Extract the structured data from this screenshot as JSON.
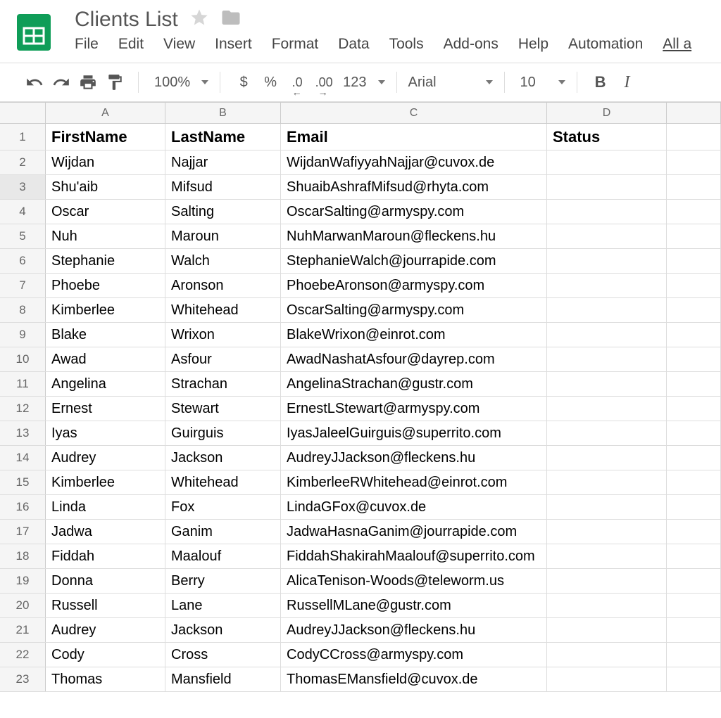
{
  "doc": {
    "title": "Clients List"
  },
  "menus": [
    "File",
    "Edit",
    "View",
    "Insert",
    "Format",
    "Data",
    "Tools",
    "Add-ons",
    "Help",
    "Automation",
    "All a"
  ],
  "toolbar": {
    "zoom": "100%",
    "currency": "$",
    "percent": "%",
    "dec_dec": ".0",
    "inc_dec": ".00",
    "more_fmt": "123",
    "font": "Arial",
    "font_size": "10",
    "bold": "B",
    "italic": "I"
  },
  "columns": [
    "A",
    "B",
    "C",
    "D",
    ""
  ],
  "headers": {
    "A": "FirstName",
    "B": "LastName",
    "C": "Email",
    "D": "Status"
  },
  "selected_row": 3,
  "rows": [
    {
      "n": 1,
      "first": "FirstName",
      "last": "LastName",
      "email": "Email",
      "status": "Status",
      "is_header": true
    },
    {
      "n": 2,
      "first": "Wijdan",
      "last": "Najjar",
      "email": "WijdanWafiyyahNajjar@cuvox.de",
      "status": ""
    },
    {
      "n": 3,
      "first": "Shu'aib",
      "last": "Mifsud",
      "email": "ShuaibAshrafMifsud@rhyta.com",
      "status": ""
    },
    {
      "n": 4,
      "first": "Oscar",
      "last": "Salting",
      "email": "OscarSalting@armyspy.com",
      "status": ""
    },
    {
      "n": 5,
      "first": "Nuh",
      "last": "Maroun",
      "email": "NuhMarwanMaroun@fleckens.hu",
      "status": ""
    },
    {
      "n": 6,
      "first": "Stephanie",
      "last": "Walch",
      "email": "StephanieWalch@jourrapide.com",
      "status": ""
    },
    {
      "n": 7,
      "first": "Phoebe",
      "last": "Aronson",
      "email": "PhoebeAronson@armyspy.com",
      "status": ""
    },
    {
      "n": 8,
      "first": "Kimberlee",
      "last": "Whitehead",
      "email": "OscarSalting@armyspy.com",
      "status": ""
    },
    {
      "n": 9,
      "first": "Blake",
      "last": "Wrixon",
      "email": "BlakeWrixon@einrot.com",
      "status": ""
    },
    {
      "n": 10,
      "first": "Awad",
      "last": "Asfour",
      "email": "AwadNashatAsfour@dayrep.com",
      "status": ""
    },
    {
      "n": 11,
      "first": "Angelina",
      "last": "Strachan",
      "email": "AngelinaStrachan@gustr.com",
      "status": ""
    },
    {
      "n": 12,
      "first": "Ernest",
      "last": "Stewart",
      "email": "ErnestLStewart@armyspy.com",
      "status": ""
    },
    {
      "n": 13,
      "first": "Iyas",
      "last": "Guirguis",
      "email": "IyasJaleelGuirguis@superrito.com",
      "status": ""
    },
    {
      "n": 14,
      "first": "Audrey",
      "last": "Jackson",
      "email": "AudreyJJackson@fleckens.hu",
      "status": ""
    },
    {
      "n": 15,
      "first": "Kimberlee",
      "last": "Whitehead",
      "email": "KimberleeRWhitehead@einrot.com",
      "status": ""
    },
    {
      "n": 16,
      "first": "Linda",
      "last": "Fox",
      "email": "LindaGFox@cuvox.de",
      "status": ""
    },
    {
      "n": 17,
      "first": "Jadwa",
      "last": "Ganim",
      "email": "JadwaHasnaGanim@jourrapide.com",
      "status": ""
    },
    {
      "n": 18,
      "first": "Fiddah",
      "last": "Maalouf",
      "email": "FiddahShakirahMaalouf@superrito.com",
      "status": ""
    },
    {
      "n": 19,
      "first": "Donna",
      "last": "Berry",
      "email": "AlicaTenison-Woods@teleworm.us",
      "status": ""
    },
    {
      "n": 20,
      "first": "Russell",
      "last": "Lane",
      "email": "RussellMLane@gustr.com",
      "status": ""
    },
    {
      "n": 21,
      "first": "Audrey",
      "last": "Jackson",
      "email": "AudreyJJackson@fleckens.hu",
      "status": ""
    },
    {
      "n": 22,
      "first": "Cody",
      "last": "Cross",
      "email": "CodyCCross@armyspy.com",
      "status": ""
    },
    {
      "n": 23,
      "first": "Thomas",
      "last": "Mansfield",
      "email": "ThomasEMansfield@cuvox.de",
      "status": ""
    }
  ]
}
